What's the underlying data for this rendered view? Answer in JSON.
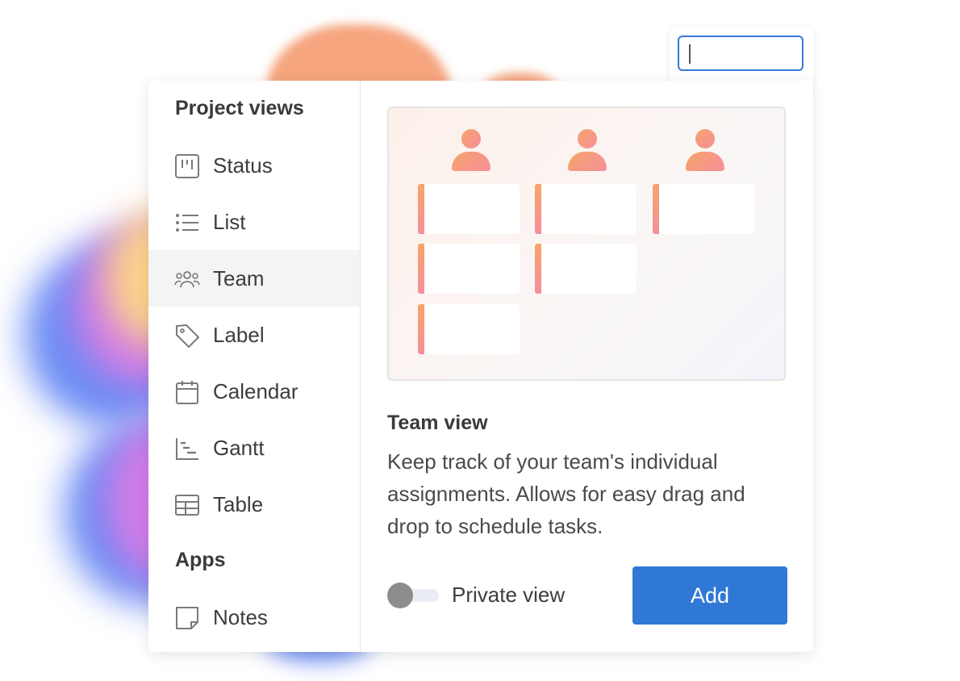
{
  "sidebar": {
    "sections": [
      {
        "title": "Project views",
        "items": [
          {
            "label": "Status",
            "icon": "status-board-icon"
          },
          {
            "label": "List",
            "icon": "list-icon"
          },
          {
            "label": "Team",
            "icon": "team-icon",
            "active": true
          },
          {
            "label": "Label",
            "icon": "tag-icon"
          },
          {
            "label": "Calendar",
            "icon": "calendar-icon"
          },
          {
            "label": "Gantt",
            "icon": "gantt-icon"
          },
          {
            "label": "Table",
            "icon": "table-icon"
          }
        ]
      },
      {
        "title": "Apps",
        "items": [
          {
            "label": "Notes",
            "icon": "note-icon"
          }
        ]
      }
    ]
  },
  "search": {
    "value": ""
  },
  "detail": {
    "title": "Team view",
    "description": "Keep track of your team's individual assignments. Allows for easy drag and drop to schedule tasks.",
    "toggle_label": "Private view",
    "toggle_on": false,
    "add_label": "Add"
  },
  "preview": {
    "columns": [
      {
        "cards": 3
      },
      {
        "cards": 2
      },
      {
        "cards": 1
      }
    ]
  },
  "colors": {
    "accent": "#2f78d6",
    "card_bar_gradient": [
      "#f7a46a",
      "#f58f9a"
    ],
    "active_row": "#f4f4f4"
  }
}
